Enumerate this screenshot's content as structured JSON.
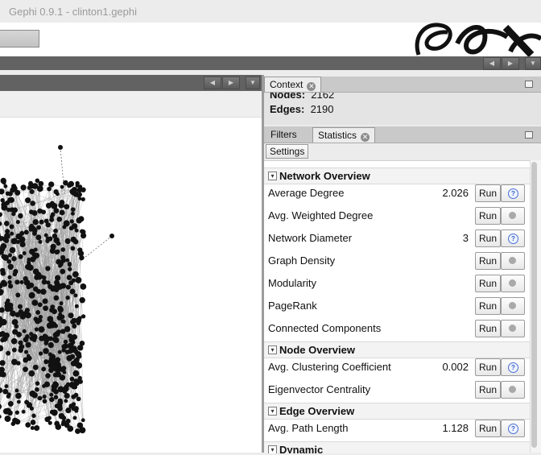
{
  "window": {
    "title": "Gephi 0.9.1 - clinton1.gephi"
  },
  "context": {
    "tab_label": "Context",
    "nodes_label": "Nodes:",
    "nodes_value": "2162",
    "edges_label": "Edges:",
    "edges_value": "2190"
  },
  "panels": {
    "filters_tab": "Filters",
    "statistics_tab": "Statistics",
    "settings_button": "Settings"
  },
  "statistics": {
    "sections": [
      {
        "title": "Network Overview"
      },
      {
        "title": "Node Overview"
      },
      {
        "title": "Edge Overview"
      },
      {
        "title": "Dynamic"
      }
    ],
    "run_label": "Run",
    "rows": [
      {
        "name": "Average Degree",
        "value": "2.026",
        "help": "info-icon"
      },
      {
        "name": "Avg. Weighted Degree",
        "value": "",
        "help": "status-dot-icon"
      },
      {
        "name": "Network Diameter",
        "value": "3",
        "help": "info-icon"
      },
      {
        "name": "Graph Density",
        "value": "",
        "help": "status-dot-icon"
      },
      {
        "name": "Modularity",
        "value": "",
        "help": "status-dot-icon"
      },
      {
        "name": "PageRank",
        "value": "",
        "help": "status-dot-icon"
      },
      {
        "name": "Connected Components",
        "value": "",
        "help": "status-dot-icon"
      },
      {
        "name": "Avg. Clustering Coefficient",
        "value": "0.002",
        "help": "info-icon"
      },
      {
        "name": "Eigenvector Centrality",
        "value": "",
        "help": "status-dot-icon"
      },
      {
        "name": "Avg. Path Length",
        "value": "1.128",
        "help": "info-icon"
      }
    ]
  },
  "colors": {
    "toolbar_dark": "#626262",
    "panel_header": "#c9c9c9",
    "help_icon": "#3a5fc8"
  }
}
